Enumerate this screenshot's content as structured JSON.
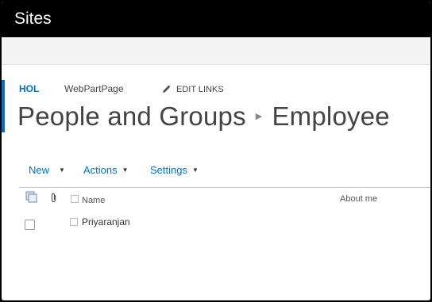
{
  "suite_bar": {
    "title": "Sites"
  },
  "top_nav": {
    "site_link": "HOL",
    "page_link": "WebPartPage",
    "edit_links": "EDIT LINKS"
  },
  "page_title": {
    "parent": "People and Groups",
    "current": "Employee"
  },
  "toolbar": {
    "new_label": "New",
    "actions_label": "Actions",
    "settings_label": "Settings"
  },
  "columns": {
    "name": "Name",
    "about": "About me"
  },
  "rows": [
    {
      "name": "Priyaranjan"
    }
  ],
  "colors": {
    "accent": "#0072c6",
    "suite_bar": "#000000"
  },
  "icons": [
    "pencil-icon",
    "breadcrumb-arrow-icon",
    "dropdown-caret-icon",
    "select-all-icon",
    "attachment-icon",
    "checkbox-icon"
  ]
}
